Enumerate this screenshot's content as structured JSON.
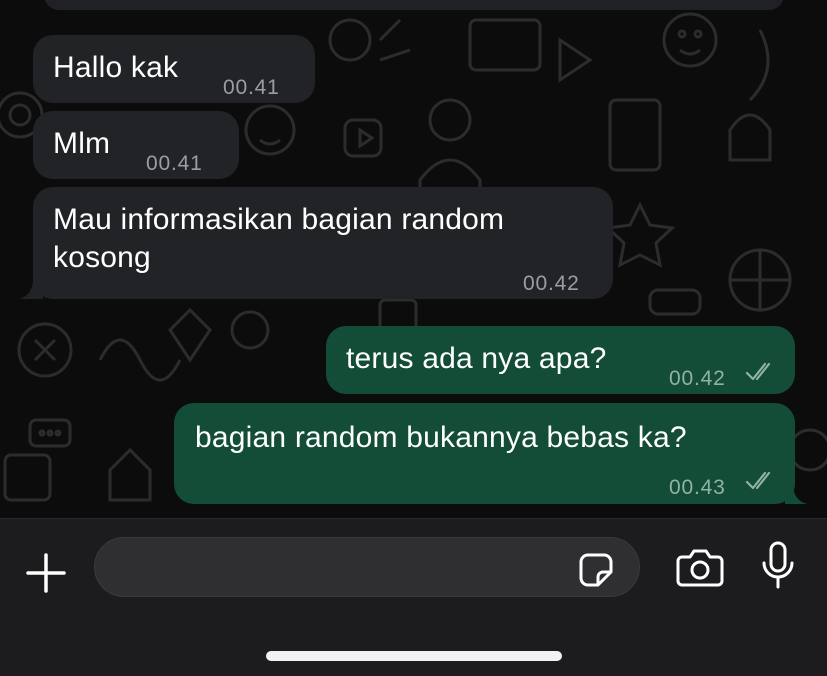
{
  "chat": {
    "messages": [
      {
        "direction": "incoming",
        "text": "Hallo kak",
        "time": "00.41"
      },
      {
        "direction": "incoming",
        "text": "Mlm",
        "time": "00.41"
      },
      {
        "direction": "incoming",
        "text": "Mau informasikan bagian random\nkosong",
        "time": "00.42"
      },
      {
        "direction": "outgoing",
        "text": "terus ada nya apa?",
        "time": "00.42",
        "status": "read"
      },
      {
        "direction": "outgoing",
        "text": "bagian random bukannya bebas ka?",
        "time": "00.43",
        "status": "read"
      }
    ]
  },
  "composer": {
    "icons": {
      "add": "plus-icon",
      "sticker": "sticker-icon",
      "camera": "camera-icon",
      "mic": "microphone-icon"
    }
  },
  "colors": {
    "incoming_bubble": "#222326",
    "outgoing_bubble": "#144d37",
    "background": "#0c0c0c",
    "input_bar": "#1c1c1e"
  }
}
